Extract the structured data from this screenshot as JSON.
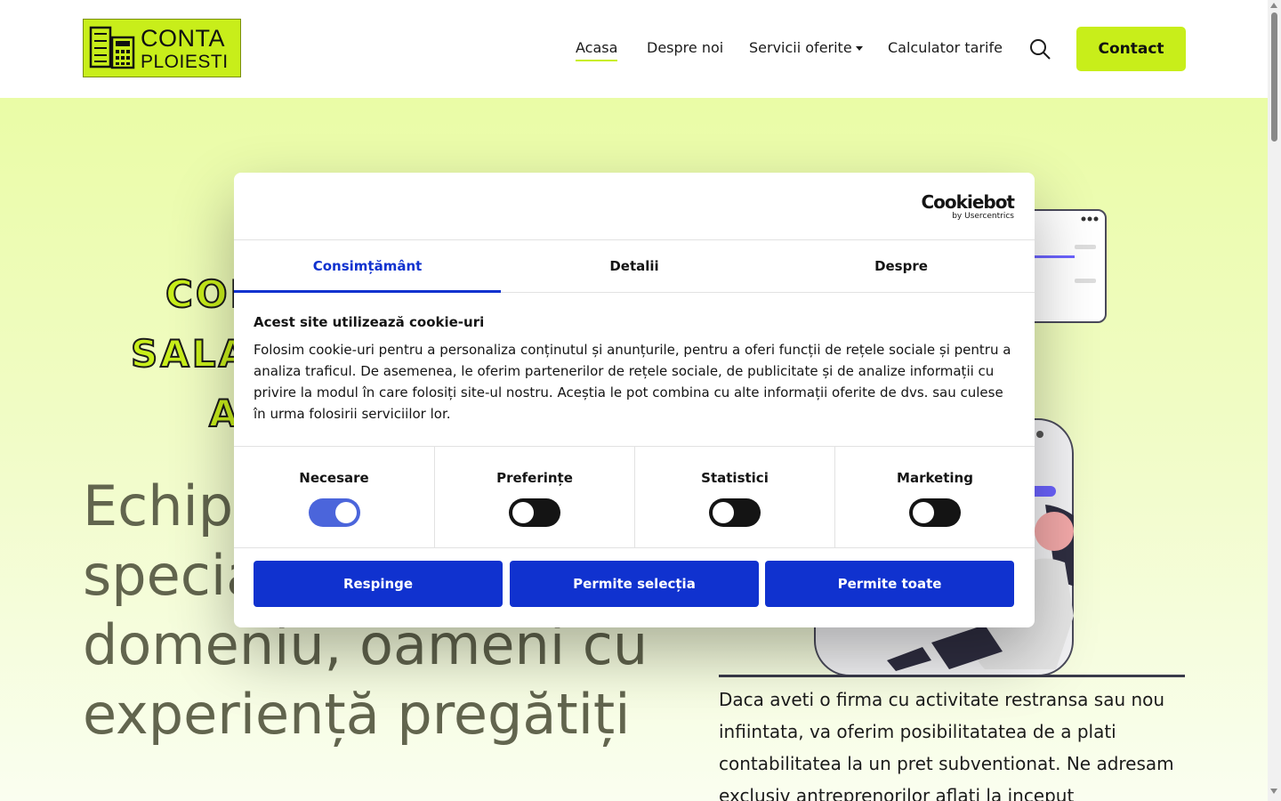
{
  "header": {
    "logo": {
      "line1": "CONTA",
      "line2": "PLOIESTI"
    },
    "nav": [
      {
        "label": "Acasa"
      },
      {
        "label": "Despre noi"
      },
      {
        "label": "Servicii oferite"
      },
      {
        "label": "Calculator tarife"
      }
    ],
    "contact_label": "Contact"
  },
  "hero": {
    "title_lines": [
      "CON",
      "SALA",
      "A"
    ],
    "big_text": "Echipa formată din specialiști în acest domeniu, oameni cu experiență pregătiți",
    "side_text": "Daca aveti o firma cu activitate restransa sau nou infiintata, va oferim posibilitatatea de a plati contabilitatea la un pret subventionat. Ne adresam exclusiv antreprenorilor aflati la inceput"
  },
  "cookie_dialog": {
    "brand": "Cookiebot",
    "brand_sub": "by Usercentrics",
    "tabs": [
      {
        "label": "Consimțământ",
        "active": true
      },
      {
        "label": "Detalii",
        "active": false
      },
      {
        "label": "Despre",
        "active": false
      }
    ],
    "heading": "Acest site utilizează cookie-uri",
    "body": "Folosim cookie-uri pentru a personaliza conținutul și anunțurile, pentru a oferi funcții de rețele sociale și pentru a analiza traficul. De asemenea, le oferim partenerilor de rețele sociale, de publicitate și de analize informații cu privire la modul în care folosiți site-ul nostru. Aceștia le pot combina cu alte informații oferite de dvs. sau culese în urma folosirii serviciilor lor.",
    "categories": [
      {
        "label": "Necesare",
        "enabled": true
      },
      {
        "label": "Preferințe",
        "enabled": false
      },
      {
        "label": "Statistici",
        "enabled": false
      },
      {
        "label": "Marketing",
        "enabled": false
      }
    ],
    "buttons": {
      "reject": "Respinge",
      "allow_selection": "Permite selecția",
      "allow_all": "Permite toate"
    }
  },
  "colors": {
    "brand_lime": "#c8ee1a",
    "cookie_blue": "#1032cf"
  }
}
